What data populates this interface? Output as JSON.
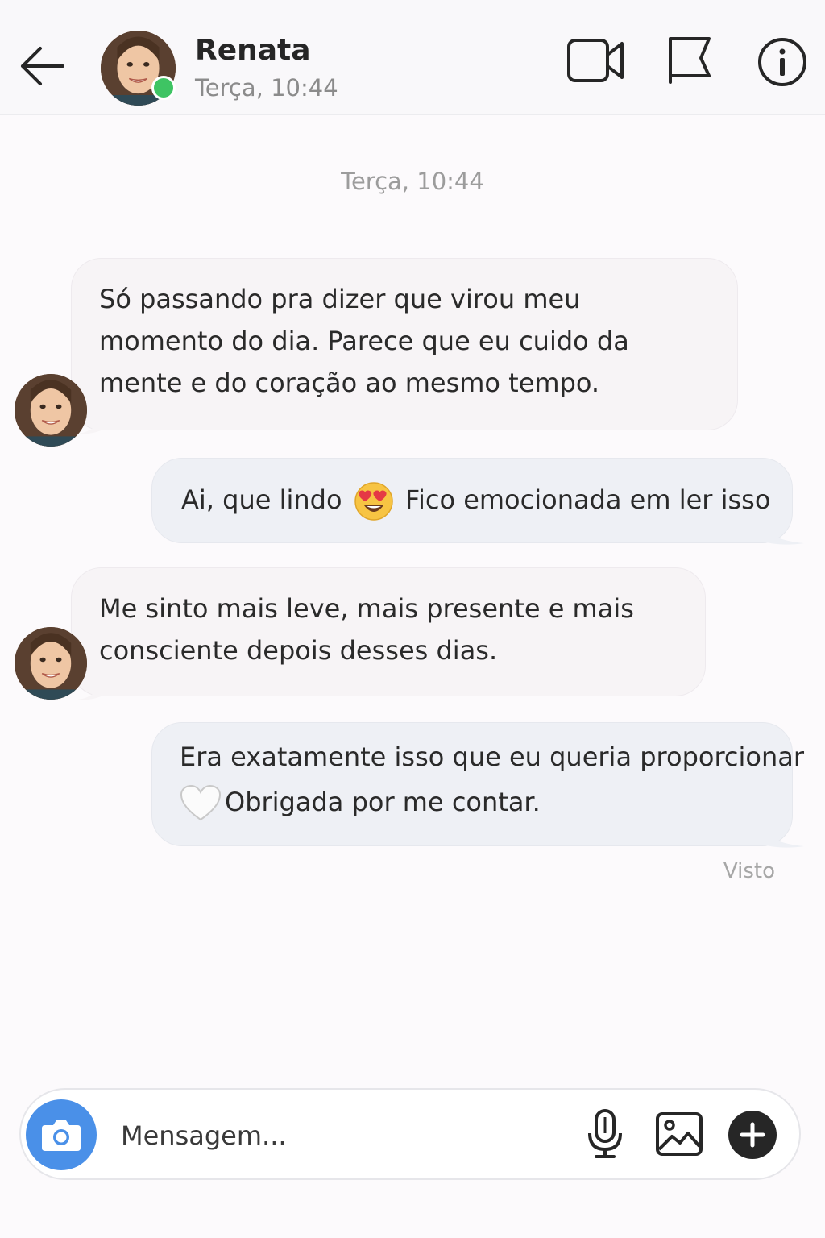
{
  "header": {
    "contact_name": "Renata",
    "status": "Terça, 10:44",
    "icons": [
      "back-arrow-icon",
      "video-camera-icon",
      "flag-icon",
      "info-icon"
    ],
    "online_color": "#3ec463"
  },
  "conversation": {
    "time_divider": "Terça, 10:44",
    "messages": [
      {
        "direction": "incoming",
        "text": "Só passando pra dizer que virou meu momento do dia. Parece que eu cuido da mente e do coração ao mesmo tempo."
      },
      {
        "direction": "outgoing",
        "text_before": "Ai, que lindo",
        "emoji": "heart-eyes-emoji",
        "text_after": "Fico emocionada em ler isso"
      },
      {
        "direction": "incoming",
        "text": "Me sinto mais leve, mais presente e mais consciente depois desses dias."
      },
      {
        "direction": "outgoing",
        "line1": "Era exatamente isso que eu queria proporcionar",
        "emoji": "white-heart-emoji",
        "line2": "Obrigada por me contar."
      }
    ],
    "seen_label": "Visto"
  },
  "composer": {
    "placeholder": "Mensagem...",
    "icons": [
      "camera-icon",
      "microphone-icon",
      "image-icon",
      "plus-icon"
    ],
    "camera_button_color": "#4a90e8"
  }
}
